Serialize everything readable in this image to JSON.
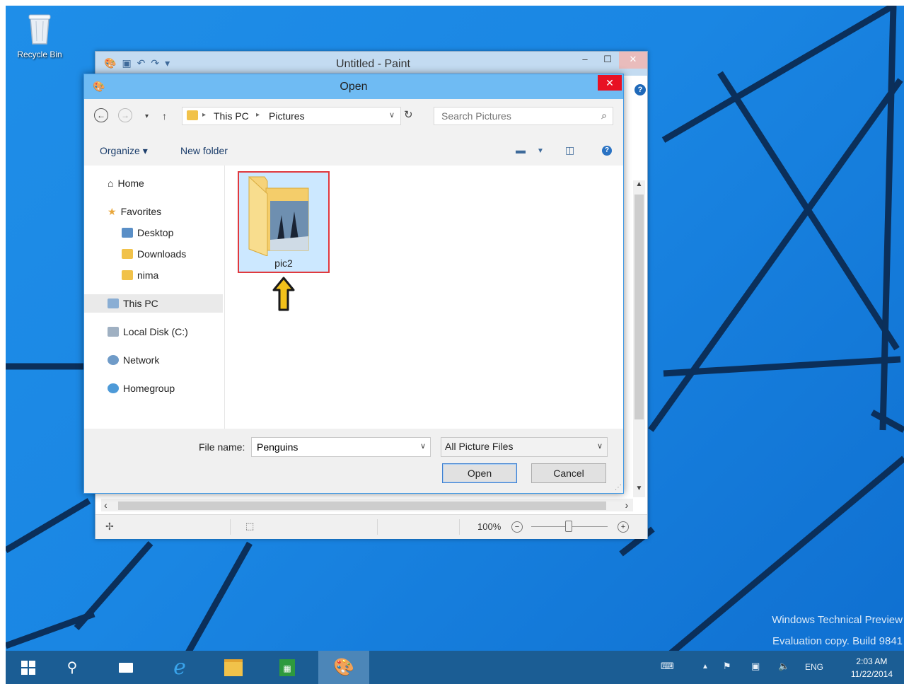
{
  "desktop": {
    "recycle_bin_label": "Recycle Bin",
    "watermark_line1": "Windows Technical Preview",
    "watermark_line2": "Evaluation copy. Build 9841"
  },
  "paint": {
    "title": "Untitled - Paint",
    "zoom": "100%",
    "qat_icons": [
      "paint-app-icon",
      "save-icon",
      "undo-icon",
      "redo-icon",
      "customize-qat-icon"
    ]
  },
  "dialog": {
    "title": "Open",
    "address": {
      "crumbs": [
        "This PC",
        "Pictures"
      ]
    },
    "search": {
      "placeholder": "Search Pictures",
      "value": ""
    },
    "toolbar": {
      "organize": "Organize ▾",
      "new_folder": "New folder"
    },
    "nav": {
      "home": "Home",
      "favorites": "Favorites",
      "desktop": "Desktop",
      "downloads": "Downloads",
      "nima": "nima",
      "this_pc": "This PC",
      "local_disk": "Local Disk (C:)",
      "network": "Network",
      "homegroup": "Homegroup"
    },
    "items": [
      {
        "name": "pic2",
        "type": "folder",
        "selected": true
      }
    ],
    "file_name_label": "File name:",
    "file_name_value": "Penguins",
    "file_type_value": "All Picture Files",
    "open_label": "Open",
    "cancel_label": "Cancel"
  },
  "taskbar": {
    "items": [
      "start-button",
      "search-button",
      "task-view-button",
      "internet-explorer",
      "file-explorer",
      "store",
      "paint"
    ],
    "active": "paint",
    "tray": {
      "language": "ENG"
    },
    "clock": {
      "time": "2:03 AM",
      "date": "11/22/2014"
    }
  },
  "colors": {
    "desktop_blue": "#1a86e3",
    "taskbar": "#1b5d94",
    "dialog_title": "#6fbbf3",
    "close_red": "#e81123",
    "selection_border": "#e0393e",
    "arrow_yellow": "#f2c11b"
  }
}
